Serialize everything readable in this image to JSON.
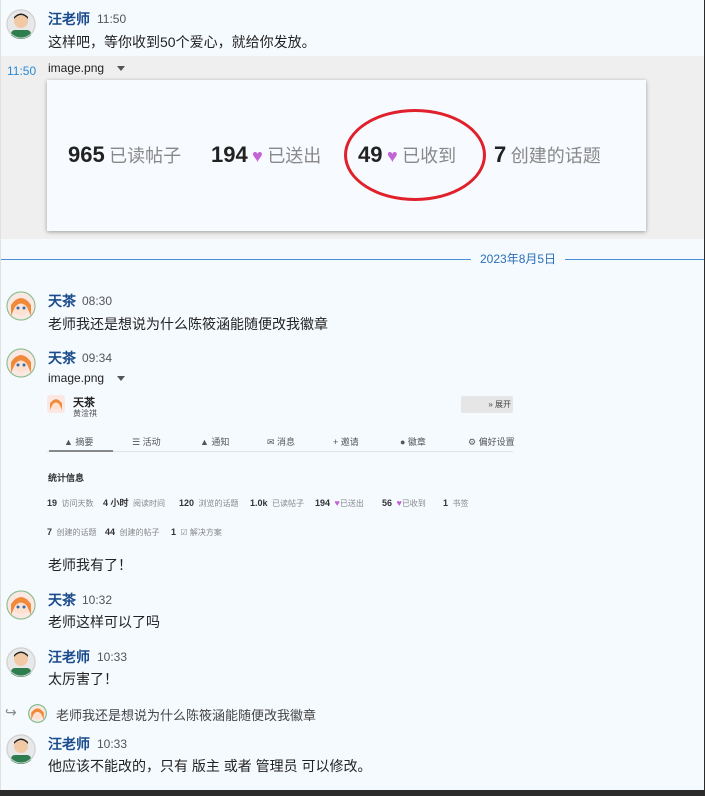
{
  "messages": [
    {
      "name": "汪老师",
      "time": "11:50",
      "text": "这样吧，等你收到50个爱心，就给你发放。"
    },
    {
      "side_time": "11:50",
      "filename": "image.png"
    },
    {
      "name": "天茶",
      "time": "08:30",
      "text": "老师我还是想说为什么陈筱涵能随便改我徽章"
    },
    {
      "name": "天茶",
      "time": "09:34",
      "filename": "image.png",
      "text_after": "老师我有了！"
    },
    {
      "name": "天茶",
      "time": "10:32",
      "text": "老师这样可以了吗"
    },
    {
      "name": "汪老师",
      "time": "10:33",
      "text": "太厉害了！"
    },
    {
      "reply_quote": "老师我还是想说为什么陈筱涵能随便改我徽章"
    },
    {
      "name": "汪老师",
      "time": "10:33",
      "text": "他应该不能改的，只有 版主 或者 管理员 可以修改。"
    }
  ],
  "date_separator": "2023年8月5日",
  "stats_card": {
    "items": [
      {
        "num": "965",
        "label": "已读帖子",
        "heart": false
      },
      {
        "num": "194",
        "label": "已送出",
        "heart": true
      },
      {
        "num": "49",
        "label": "已收到",
        "heart": true
      },
      {
        "num": "7",
        "label": "创建的话题",
        "heart": false
      }
    ],
    "heart_color": "#c263d6",
    "circle_color": "#e0202a"
  },
  "profile_shot": {
    "name": "天茶",
    "subtitle": "黄淦祺",
    "expand": "» 展开",
    "tabs": [
      "▲ 摘要",
      "☰ 活动",
      "▲ 通知",
      "✉ 消息",
      "+ 邀请",
      "● 徽章",
      "⚙ 偏好设置"
    ],
    "section_title": "统计信息",
    "row1": [
      {
        "num": "19",
        "label": "访问天数"
      },
      {
        "num": "4 小时",
        "label": "阅读时间"
      },
      {
        "num": "120",
        "label": "浏览的话题"
      },
      {
        "num": "1.0k",
        "label": "已读帖子"
      },
      {
        "num": "194",
        "label": "已送出",
        "heart": true
      },
      {
        "num": "56",
        "label": "已收到",
        "heart": true
      },
      {
        "num": "1",
        "label": "书签"
      }
    ],
    "row2": [
      {
        "num": "7",
        "label": "创建的话题"
      },
      {
        "num": "44",
        "label": "创建的帖子"
      },
      {
        "num": "1",
        "label": "☑ 解决方案"
      }
    ]
  },
  "colors": {
    "name": "#1a4b8c",
    "accent": "#2a8bd6",
    "bg": "#f5faff"
  }
}
